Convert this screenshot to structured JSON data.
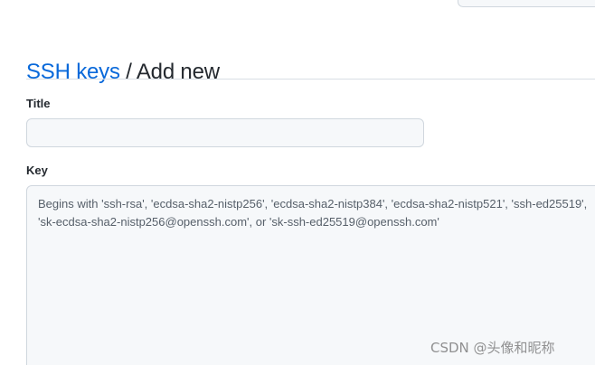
{
  "header": {
    "breadcrumb_link": "SSH keys",
    "breadcrumb_separator": " / ",
    "breadcrumb_current": "Add new"
  },
  "form": {
    "title_label": "Title",
    "title_value": "",
    "title_placeholder": "",
    "key_label": "Key",
    "key_value": "",
    "key_placeholder": "Begins with 'ssh-rsa', 'ecdsa-sha2-nistp256', 'ecdsa-sha2-nistp384', 'ecdsa-sha2-nistp521', 'ssh-ed25519', 'sk-ecdsa-sha2-nistp256@openssh.com', or 'sk-ssh-ed25519@openssh.com'"
  },
  "watermark": {
    "text": "CSDN @头像和昵称"
  },
  "colors": {
    "link": "#0969da",
    "text": "#24292f",
    "input_bg": "#f6f8fa",
    "border": "#d0d7de"
  }
}
